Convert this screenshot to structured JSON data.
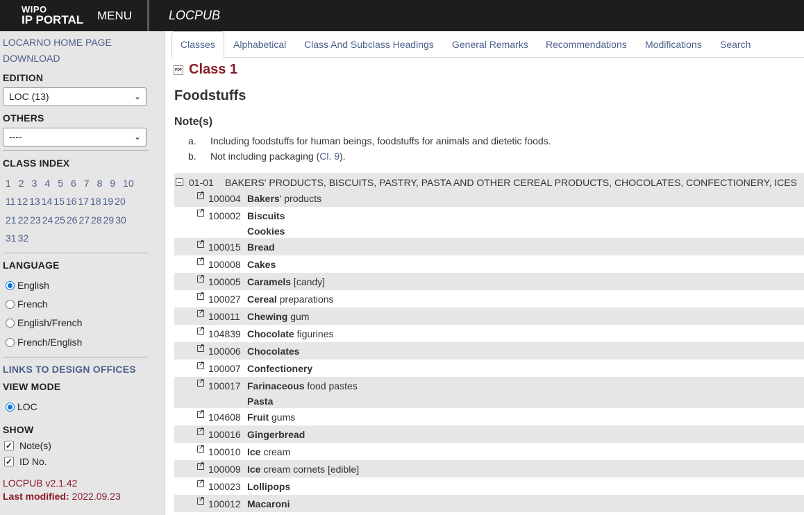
{
  "header": {
    "logo_line1": "WIPO",
    "logo_line2": "IP PORTAL",
    "menu_label": "MENU",
    "app_title": "LOCPUB"
  },
  "sidebar": {
    "home_link": "LOCARNO HOME PAGE",
    "download_link": "DOWNLOAD",
    "edition_label": "EDITION",
    "edition_value": "LOC (13)",
    "others_label": "OTHERS",
    "others_value": "----",
    "class_index_label": "CLASS INDEX",
    "class_rows": [
      [
        "1",
        "2",
        "3",
        "4",
        "5",
        "6",
        "7",
        "8",
        "9",
        "10"
      ],
      [
        "11",
        "12",
        "13",
        "14",
        "15",
        "16",
        "17",
        "18",
        "19",
        "20"
      ],
      [
        "21",
        "22",
        "23",
        "24",
        "25",
        "26",
        "27",
        "28",
        "29",
        "30"
      ],
      [
        "31",
        "32"
      ]
    ],
    "language_label": "LANGUAGE",
    "languages": [
      "English",
      "French",
      "English/French",
      "French/English"
    ],
    "selected_language": "English",
    "links_design_offices": "LINKS TO DESIGN OFFICES",
    "view_mode_label": "VIEW MODE",
    "view_mode_value": "LOC",
    "show_label": "SHOW",
    "show_notes": "Note(s)",
    "show_id": "ID No.",
    "version_name": "LOCPUB",
    "version_number": "v2.1.42",
    "last_modified_label": "Last modified:",
    "last_modified_value": "2022.09.23"
  },
  "tabs": [
    "Classes",
    "Alphabetical",
    "Class And Subclass Headings",
    "General Remarks",
    "Recommendations",
    "Modifications",
    "Search"
  ],
  "main": {
    "class_title": "Class 1",
    "class_name": "Foodstuffs",
    "notes_heading": "Note(s)",
    "note_a_letter": "a.",
    "note_a_text": "Including foodstuffs for human beings, foodstuffs for animals and dietetic foods.",
    "note_b_letter": "b.",
    "note_b_prefix": "Not including packaging (",
    "note_b_link": "Cl. 9",
    "note_b_suffix": ").",
    "subclass_code": "01-01",
    "subclass_title": "BAKERS' PRODUCTS, BISCUITS, PASTRY, PASTA AND OTHER CEREAL PRODUCTS, CHOCOLATES, CONFECTIONERY, ICES",
    "items": [
      {
        "id": "100004",
        "bold": "Bakers",
        "rest": "' products"
      },
      {
        "id": "100002",
        "bold": "Biscuits",
        "rest": "",
        "line2": "Cookies"
      },
      {
        "id": "100015",
        "bold": "Bread",
        "rest": ""
      },
      {
        "id": "100008",
        "bold": "Cakes",
        "rest": ""
      },
      {
        "id": "100005",
        "bold": "Caramels",
        "rest": " [candy]"
      },
      {
        "id": "100027",
        "bold": "Cereal",
        "rest": " preparations"
      },
      {
        "id": "100011",
        "bold": "Chewing",
        "rest": " gum"
      },
      {
        "id": "104839",
        "bold": "Chocolate",
        "rest": " figurines"
      },
      {
        "id": "100006",
        "bold": "Chocolates",
        "rest": ""
      },
      {
        "id": "100007",
        "bold": "Confectionery",
        "rest": ""
      },
      {
        "id": "100017",
        "bold": "Farinaceous",
        "rest": " food pastes",
        "line2": "Pasta"
      },
      {
        "id": "104608",
        "bold": "Fruit",
        "rest": " gums"
      },
      {
        "id": "100016",
        "bold": "Gingerbread",
        "rest": ""
      },
      {
        "id": "100010",
        "bold": "Ice",
        "rest": " cream"
      },
      {
        "id": "100009",
        "bold": "Ice",
        "rest": " cream cornets [edible]"
      },
      {
        "id": "100023",
        "bold": "Lollipops",
        "rest": ""
      },
      {
        "id": "100012",
        "bold": "Macaroni",
        "rest": ""
      }
    ]
  }
}
